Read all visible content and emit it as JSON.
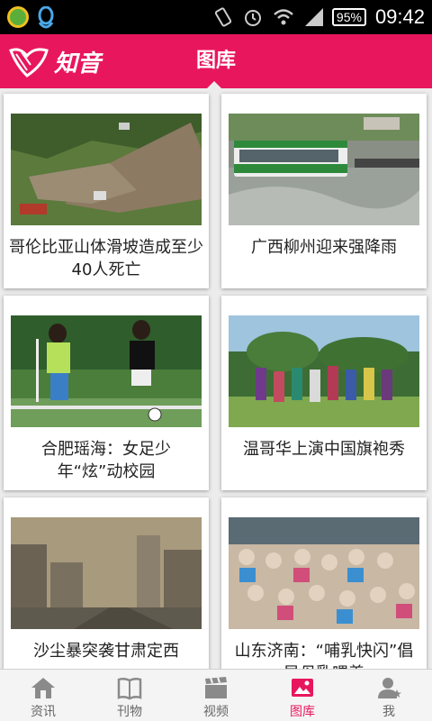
{
  "status_bar": {
    "battery": "95%",
    "time": "09:42"
  },
  "header": {
    "logo_text": "知音",
    "title": "图库"
  },
  "gallery": [
    {
      "caption": "哥伦比亚山体滑坡造成至少40人死亡"
    },
    {
      "caption": "广西柳州迎来强降雨"
    },
    {
      "caption": "合肥瑶海：女足少年“炫”动校园"
    },
    {
      "caption": "温哥华上演中国旗袍秀"
    },
    {
      "caption": "沙尘暴突袭甘肃定西"
    },
    {
      "caption": "山东济南：“哺乳快闪”倡导母乳喂养"
    }
  ],
  "tabs": [
    {
      "label": "资讯",
      "icon": "home-icon",
      "active": false
    },
    {
      "label": "刊物",
      "icon": "book-icon",
      "active": false
    },
    {
      "label": "视频",
      "icon": "film-icon",
      "active": false
    },
    {
      "label": "图库",
      "icon": "picture-icon",
      "active": true
    },
    {
      "label": "我",
      "icon": "user-icon",
      "active": false
    }
  ],
  "colors": {
    "accent": "#e8175d",
    "background": "#ececec"
  }
}
